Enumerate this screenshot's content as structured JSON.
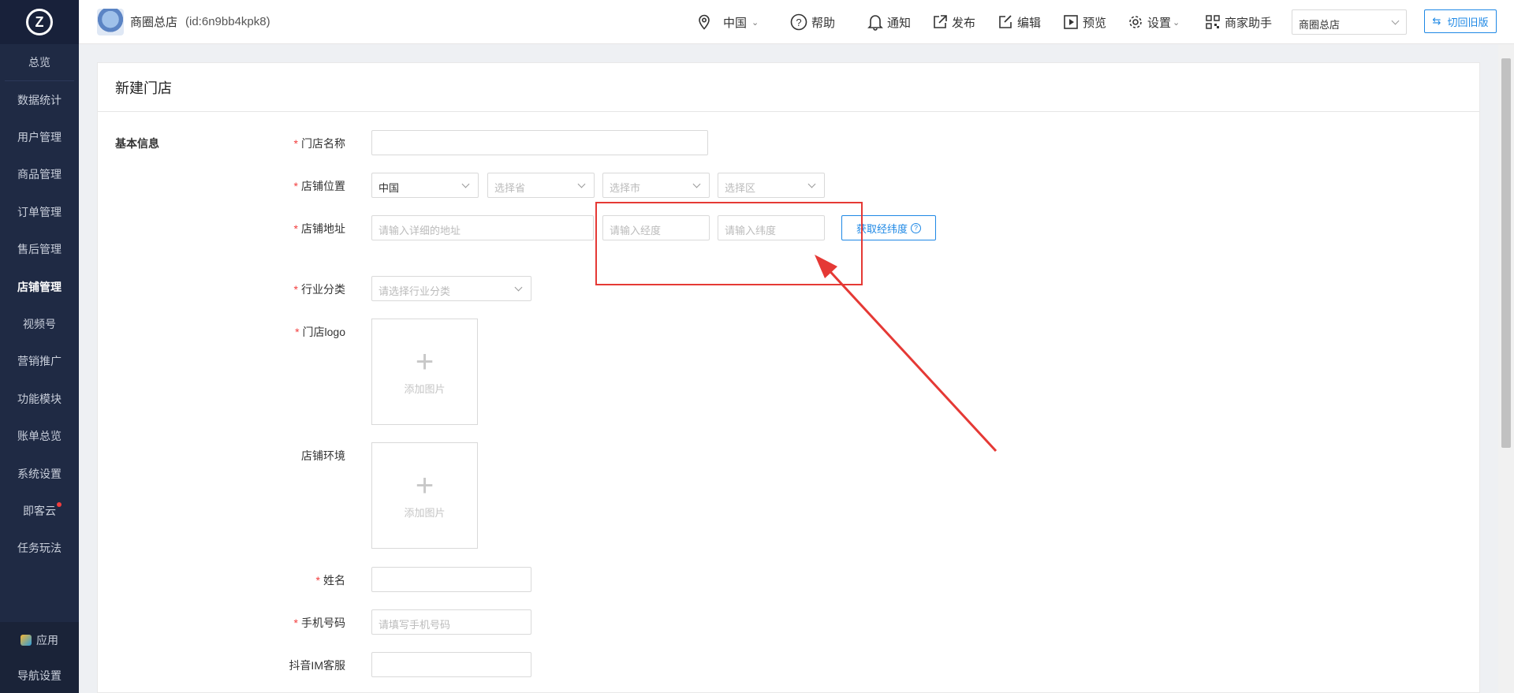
{
  "sidebar": {
    "logo_letter": "Z",
    "items": [
      {
        "label": "总览"
      },
      {
        "label": "数据统计"
      },
      {
        "label": "用户管理"
      },
      {
        "label": "商品管理"
      },
      {
        "label": "订单管理"
      },
      {
        "label": "售后管理"
      },
      {
        "label": "店铺管理"
      },
      {
        "label": "视频号"
      },
      {
        "label": "营销推广"
      },
      {
        "label": "功能模块"
      },
      {
        "label": "账单总览"
      },
      {
        "label": "系统设置"
      },
      {
        "label": "即客云"
      },
      {
        "label": "任务玩法"
      }
    ],
    "bottom": {
      "apps": "应用",
      "nav_settings": "导航设置"
    }
  },
  "header": {
    "store_name": "商圈总店",
    "store_id": "(id:6n9bb4kpk8)",
    "region": "中国",
    "help": "帮助",
    "notify": "通知",
    "publish": "发布",
    "edit": "编辑",
    "preview": "预览",
    "settings": "设置",
    "assistant": "商家助手",
    "store_select": "商圈总店",
    "switch_old": "切回旧版"
  },
  "page": {
    "title": "新建门店",
    "section": "基本信息"
  },
  "form": {
    "store_name": {
      "label": "门店名称",
      "value": ""
    },
    "location": {
      "label": "店铺位置",
      "country": "中国",
      "province_placeholder": "选择省",
      "city_placeholder": "选择市",
      "district_placeholder": "选择区"
    },
    "address": {
      "label": "店铺地址",
      "detail_placeholder": "请输入详细的地址",
      "longitude_placeholder": "请输入经度",
      "latitude_placeholder": "请输入纬度",
      "get_coords_button": "获取经纬度",
      "help_mark": "?"
    },
    "industry": {
      "label": "行业分类",
      "placeholder": "请选择行业分类"
    },
    "logo": {
      "label": "门店logo",
      "upload_text": "添加图片"
    },
    "environment": {
      "label": "店铺环境",
      "upload_text": "添加图片"
    },
    "name": {
      "label": "姓名",
      "value": ""
    },
    "phone": {
      "label": "手机号码",
      "placeholder": "请填写手机号码"
    },
    "douyin": {
      "label": "抖音IM客服",
      "value": ""
    }
  },
  "colors": {
    "sidebar_bg": "#1f2a44",
    "accent": "#1e88e5",
    "required": "#f23d3d",
    "annotation": "#e53935"
  }
}
